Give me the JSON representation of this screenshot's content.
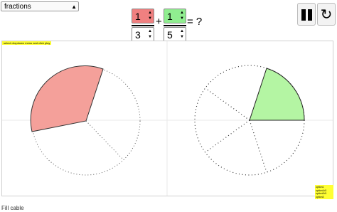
{
  "selector": {
    "value": "fractions"
  },
  "fractions": {
    "first": {
      "numerator": "1",
      "denominator": "3",
      "color": "#f08080"
    },
    "plus": "+",
    "second": {
      "numerator": "1",
      "denominator": "5",
      "color": "#90ee90"
    },
    "equals_q": "= ?"
  },
  "hint": "select dropdown menu and click play",
  "legend": [
    "option1",
    "option1d1",
    "option2d1",
    "option3"
  ],
  "footer": "Fill cable",
  "icons": {
    "pause": "pause-icon",
    "restart": "restart-icon",
    "spinner": "spinner-arrows-icon",
    "dropdown": "chevron-down-icon"
  }
}
